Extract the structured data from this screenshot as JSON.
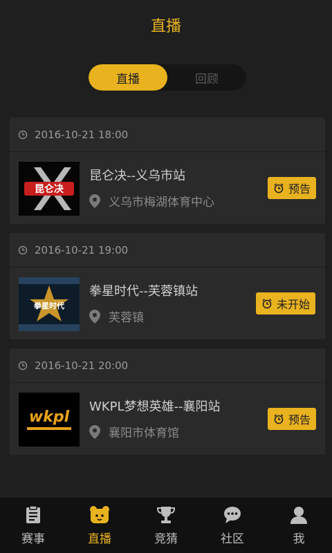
{
  "header": {
    "title": "直播"
  },
  "segment": {
    "tabs": [
      "直播",
      "回顾"
    ],
    "active": 0
  },
  "events": [
    {
      "time": "2016-10-21 18:00",
      "title": "昆仑决--义乌市站",
      "venue": "义乌市梅湖体育中心",
      "badge": "预告",
      "logo_text": "昆仑决"
    },
    {
      "time": "2016-10-21 19:00",
      "title": "拳星时代--芙蓉镇站",
      "venue": "芙蓉镇",
      "badge": "未开始",
      "logo_text": "拳星时代"
    },
    {
      "time": "2016-10-21 20:00",
      "title": "WKPL梦想英雄--襄阳站",
      "venue": "襄阳市体育馆",
      "badge": "预告",
      "logo_text": "wkpl"
    }
  ],
  "tabbar": {
    "items": [
      {
        "label": "赛事",
        "icon": "clipboard-icon"
      },
      {
        "label": "直播",
        "icon": "bear-icon"
      },
      {
        "label": "竞猜",
        "icon": "trophy-icon"
      },
      {
        "label": "社区",
        "icon": "chat-icon"
      },
      {
        "label": "我",
        "icon": "user-icon"
      }
    ],
    "active": 1
  },
  "colors": {
    "accent": "#e9b21f",
    "background": "#1f1f1f",
    "card": "#2a2a2a",
    "tabbar": "#111111"
  }
}
